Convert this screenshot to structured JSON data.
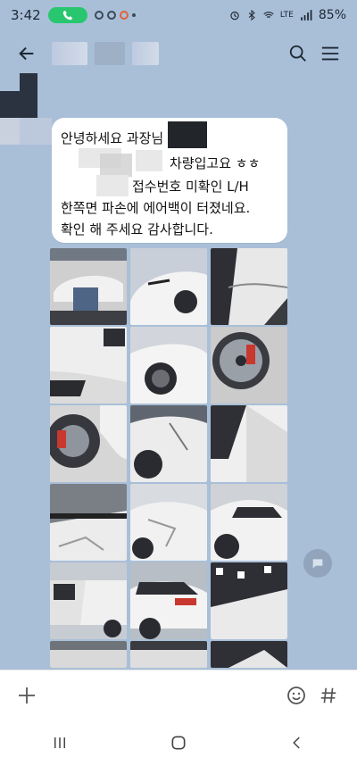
{
  "status_bar": {
    "time": "3:42",
    "network": "LTE",
    "battery": "85%"
  },
  "chat": {
    "message_lines": [
      "안녕하세요 과장님",
      "차량입고요 ㅎㅎ",
      "접수번호 미확인  L/H",
      "한쪽면 파손에 에어백이 터졌네요.",
      "확인 해 주세요 감사합니다."
    ]
  },
  "input": {
    "placeholder": ""
  },
  "icons": {
    "back": "arrow-left-icon",
    "search": "search-icon",
    "menu": "hamburger-menu-icon",
    "add": "plus-icon",
    "emoji": "emoji-icon",
    "hashtag": "hashtag-icon",
    "nav_recent": "recent-apps-icon",
    "nav_home": "home-icon",
    "nav_back": "back-icon"
  },
  "colors": {
    "chat_background": "#a9bfd8",
    "bubble": "#ffffff",
    "call_indicator": "#28c76f"
  }
}
